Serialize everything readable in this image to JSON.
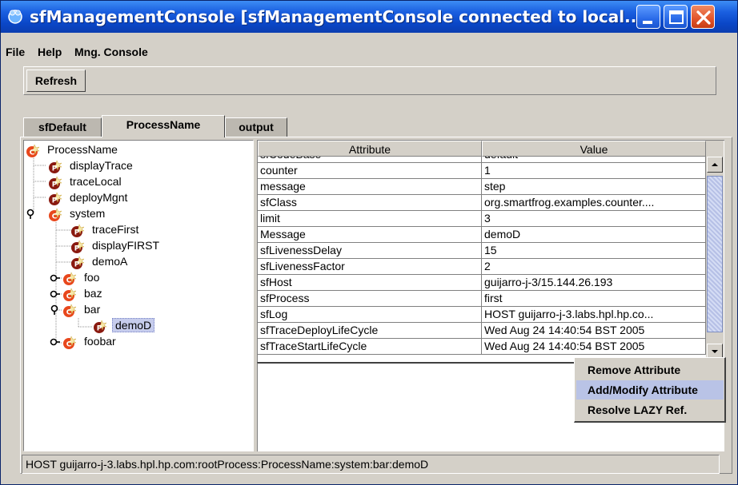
{
  "window": {
    "title": "sfManagementConsole  [sfManagementConsole connected to local...",
    "controls": [
      "minimize",
      "maximize",
      "close"
    ]
  },
  "menu": {
    "items": [
      {
        "label": "File"
      },
      {
        "label": "Help"
      },
      {
        "label": "Mng. Console"
      }
    ]
  },
  "toolbar": {
    "refresh_label": "Refresh"
  },
  "tabs": [
    {
      "label": "sfDefault",
      "active": false
    },
    {
      "label": "ProcessName",
      "active": true
    },
    {
      "label": "output",
      "active": false
    }
  ],
  "tree": {
    "nodes": [
      {
        "label": "ProcessName",
        "type": "component",
        "depth": 0
      },
      {
        "label": "displayTrace",
        "type": "primitive",
        "depth": 1
      },
      {
        "label": "traceLocal",
        "type": "primitive",
        "depth": 1
      },
      {
        "label": "deployMgnt",
        "type": "primitive",
        "depth": 1
      },
      {
        "label": "system",
        "type": "component",
        "depth": 1,
        "expanded": true
      },
      {
        "label": "traceFirst",
        "type": "primitive",
        "depth": 2
      },
      {
        "label": "displayFIRST",
        "type": "primitive",
        "depth": 2
      },
      {
        "label": "demoA",
        "type": "primitive",
        "depth": 2
      },
      {
        "label": "foo",
        "type": "component",
        "depth": 2,
        "expanded": false
      },
      {
        "label": "baz",
        "type": "component",
        "depth": 2,
        "expanded": false
      },
      {
        "label": "bar",
        "type": "component",
        "depth": 2,
        "expanded": true
      },
      {
        "label": "demoD",
        "type": "primitive",
        "depth": 3,
        "selected": true
      },
      {
        "label": "foobar",
        "type": "component",
        "depth": 2,
        "expanded": false
      }
    ]
  },
  "table": {
    "columns": [
      "Attribute",
      "Value"
    ],
    "partial_top_row": {
      "attribute": "sfCodeBase",
      "value": "default"
    },
    "rows": [
      {
        "attribute": "counter",
        "value": "1"
      },
      {
        "attribute": "message",
        "value": "step"
      },
      {
        "attribute": "sfClass",
        "value": "org.smartfrog.examples.counter...."
      },
      {
        "attribute": "limit",
        "value": "3"
      },
      {
        "attribute": "Message",
        "value": "demoD"
      },
      {
        "attribute": "sfLivenessDelay",
        "value": "15"
      },
      {
        "attribute": "sfLivenessFactor",
        "value": "2"
      },
      {
        "attribute": "sfHost",
        "value": "guijarro-j-3/15.144.26.193"
      },
      {
        "attribute": "sfProcess",
        "value": "first"
      },
      {
        "attribute": "sfLog",
        "value": "HOST guijarro-j-3.labs.hpl.hp.co..."
      },
      {
        "attribute": "sfTraceDeployLifeCycle",
        "value": "Wed Aug 24 14:40:54 BST 2005"
      },
      {
        "attribute": "sfTraceStartLifeCycle",
        "value": "Wed Aug 24 14:40:54 BST 2005"
      }
    ]
  },
  "context_menu": {
    "items": [
      {
        "label": "Remove Attribute",
        "highlighted": false
      },
      {
        "label": "Add/Modify Attribute",
        "highlighted": true
      },
      {
        "label": "Resolve LAZY Ref.",
        "highlighted": false
      }
    ]
  },
  "status": {
    "text": "HOST guijarro-j-3.labs.hpl.hp.com:rootProcess:ProcessName:system:bar:demoD"
  },
  "colors": {
    "title_bar": "#0a47c8",
    "window_bg": "#d4d0c8",
    "selection": "#c6ccec",
    "menu_highlight": "#b9c3e6",
    "component_icon": "#e8471c",
    "primitive_icon": "#8a1a10"
  }
}
